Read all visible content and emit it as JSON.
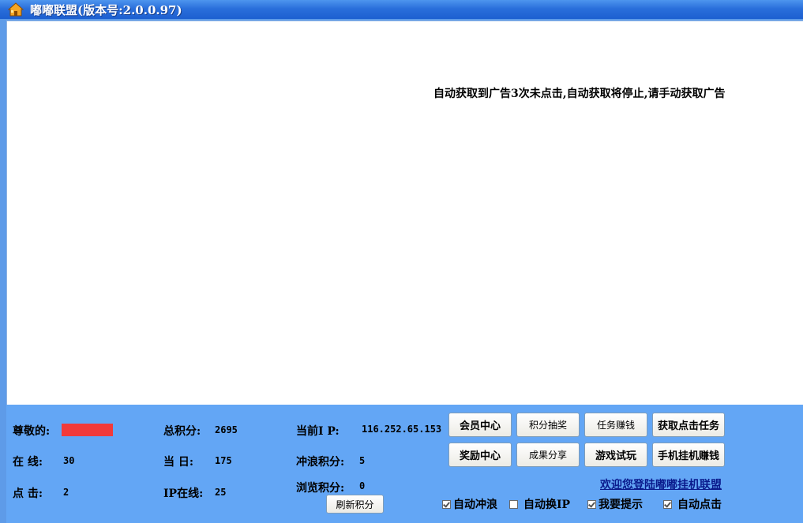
{
  "window": {
    "title": "嘟嘟联盟(版本号:2.0.0.97)",
    "icon": "home-icon"
  },
  "content": {
    "notice": "自动获取到广告3次未点击,自动获取将停止,请手动获取广告"
  },
  "stats": {
    "respected_label": "尊敬的:",
    "online_label": "在  线:",
    "online_value": "30",
    "click_label": "点  击:",
    "click_value": "2",
    "total_label": "总积分:",
    "total_value": "2695",
    "today_label": "当  日:",
    "today_value": "175",
    "ip_online_label": "IP在线:",
    "ip_online_value": "25",
    "current_ip_label": "当前I P:",
    "current_ip_value": "116.252.65.153",
    "surf_label": "冲浪积分:",
    "surf_value": "5",
    "browse_label": "浏览积分:",
    "browse_value": "0",
    "redacted_color": "#f23a3a"
  },
  "buttons": {
    "refresh": "刷新积分",
    "member_center": "会员中心",
    "points_lottery": "积分抽奖",
    "task_earn": "任务赚钱",
    "get_click_task": "获取点击任务",
    "reward_center": "奖励中心",
    "results_share": "成果分享",
    "game_trial": "游戏试玩",
    "mobile_hangup_earn": "手机挂机赚钱"
  },
  "welcome_link": "欢迎您登陆嘟嘟挂机联盟",
  "checkboxes": [
    {
      "label": "自动冲浪",
      "checked": true
    },
    {
      "label": "自动换IP",
      "checked": false
    },
    {
      "label": "我要提示",
      "checked": true
    },
    {
      "label": "自动点击",
      "checked": true
    }
  ],
  "colors": {
    "panel": "#63a6f5",
    "titlebar": "#2a6fdb",
    "content": "#ffffff"
  }
}
